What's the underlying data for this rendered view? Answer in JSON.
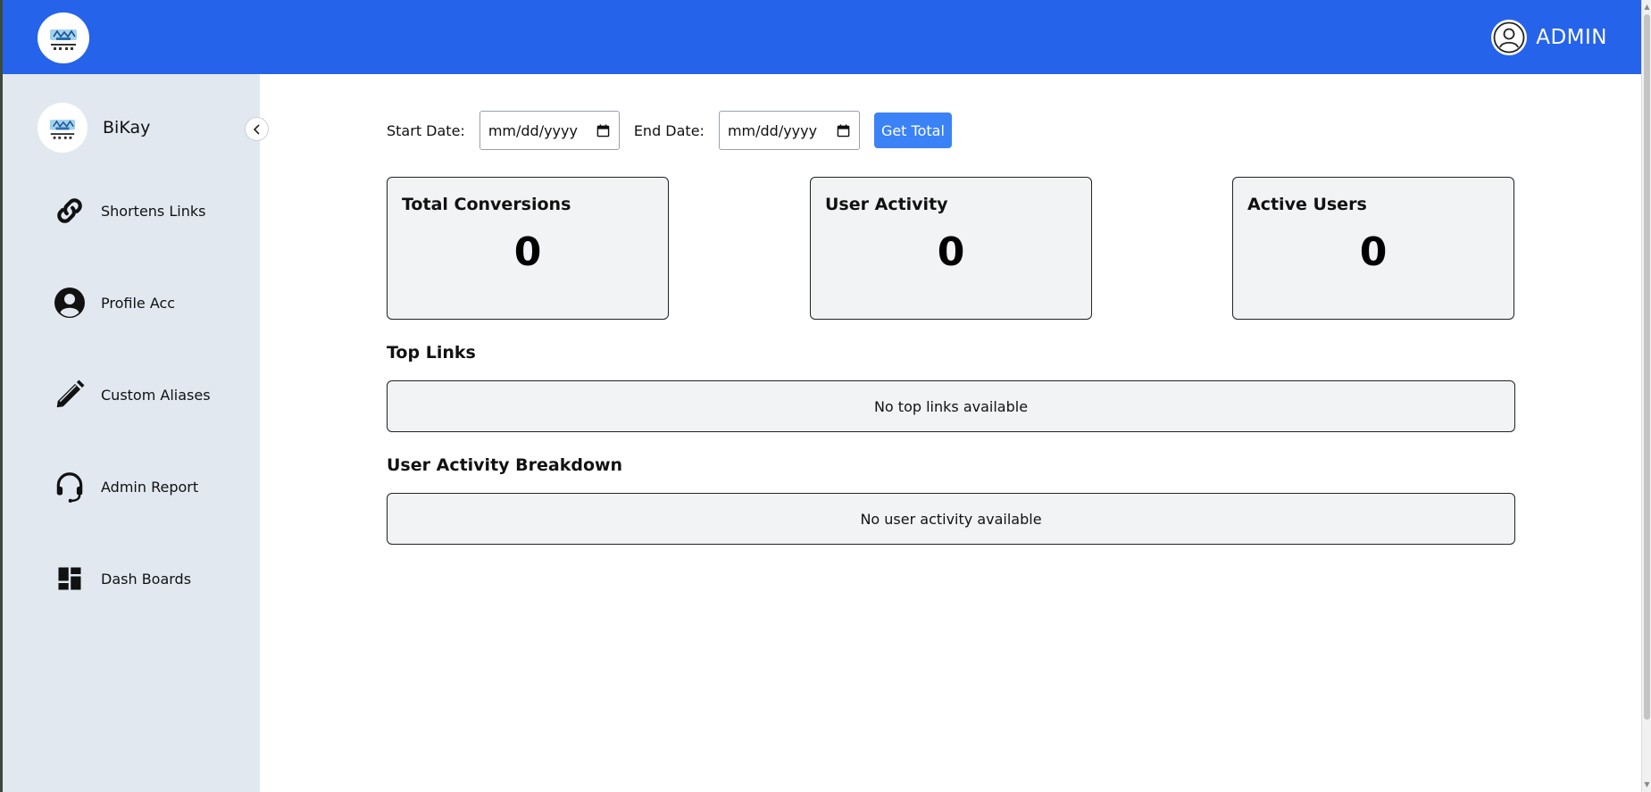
{
  "header": {
    "user_label": "ADMIN",
    "bg_color": "#2563eb"
  },
  "sidebar": {
    "brand_name": "BiKay",
    "collapse_icon": "chevron-left-icon",
    "items": [
      {
        "label": "Shortens Links",
        "icon": "link-icon"
      },
      {
        "label": "Profile Acc",
        "icon": "user-circle-icon"
      },
      {
        "label": "Custom Aliases",
        "icon": "pencil-icon"
      },
      {
        "label": "Admin Report",
        "icon": "headset-icon"
      },
      {
        "label": "Dash Boards",
        "icon": "dashboard-icon"
      }
    ]
  },
  "filters": {
    "start_label": "Start Date:",
    "start_value": "mm/dd/yyyy",
    "end_label": "End Date:",
    "end_value": "mm/dd/yyyy",
    "submit_label": "Get Total"
  },
  "stats": [
    {
      "title": "Total Conversions",
      "value": "0"
    },
    {
      "title": "User Activity",
      "value": "0"
    },
    {
      "title": "Active Users",
      "value": "0"
    }
  ],
  "top_links": {
    "title": "Top Links",
    "empty_text": "No top links available"
  },
  "activity_breakdown": {
    "title": "User Activity Breakdown",
    "empty_text": "No user activity available"
  }
}
